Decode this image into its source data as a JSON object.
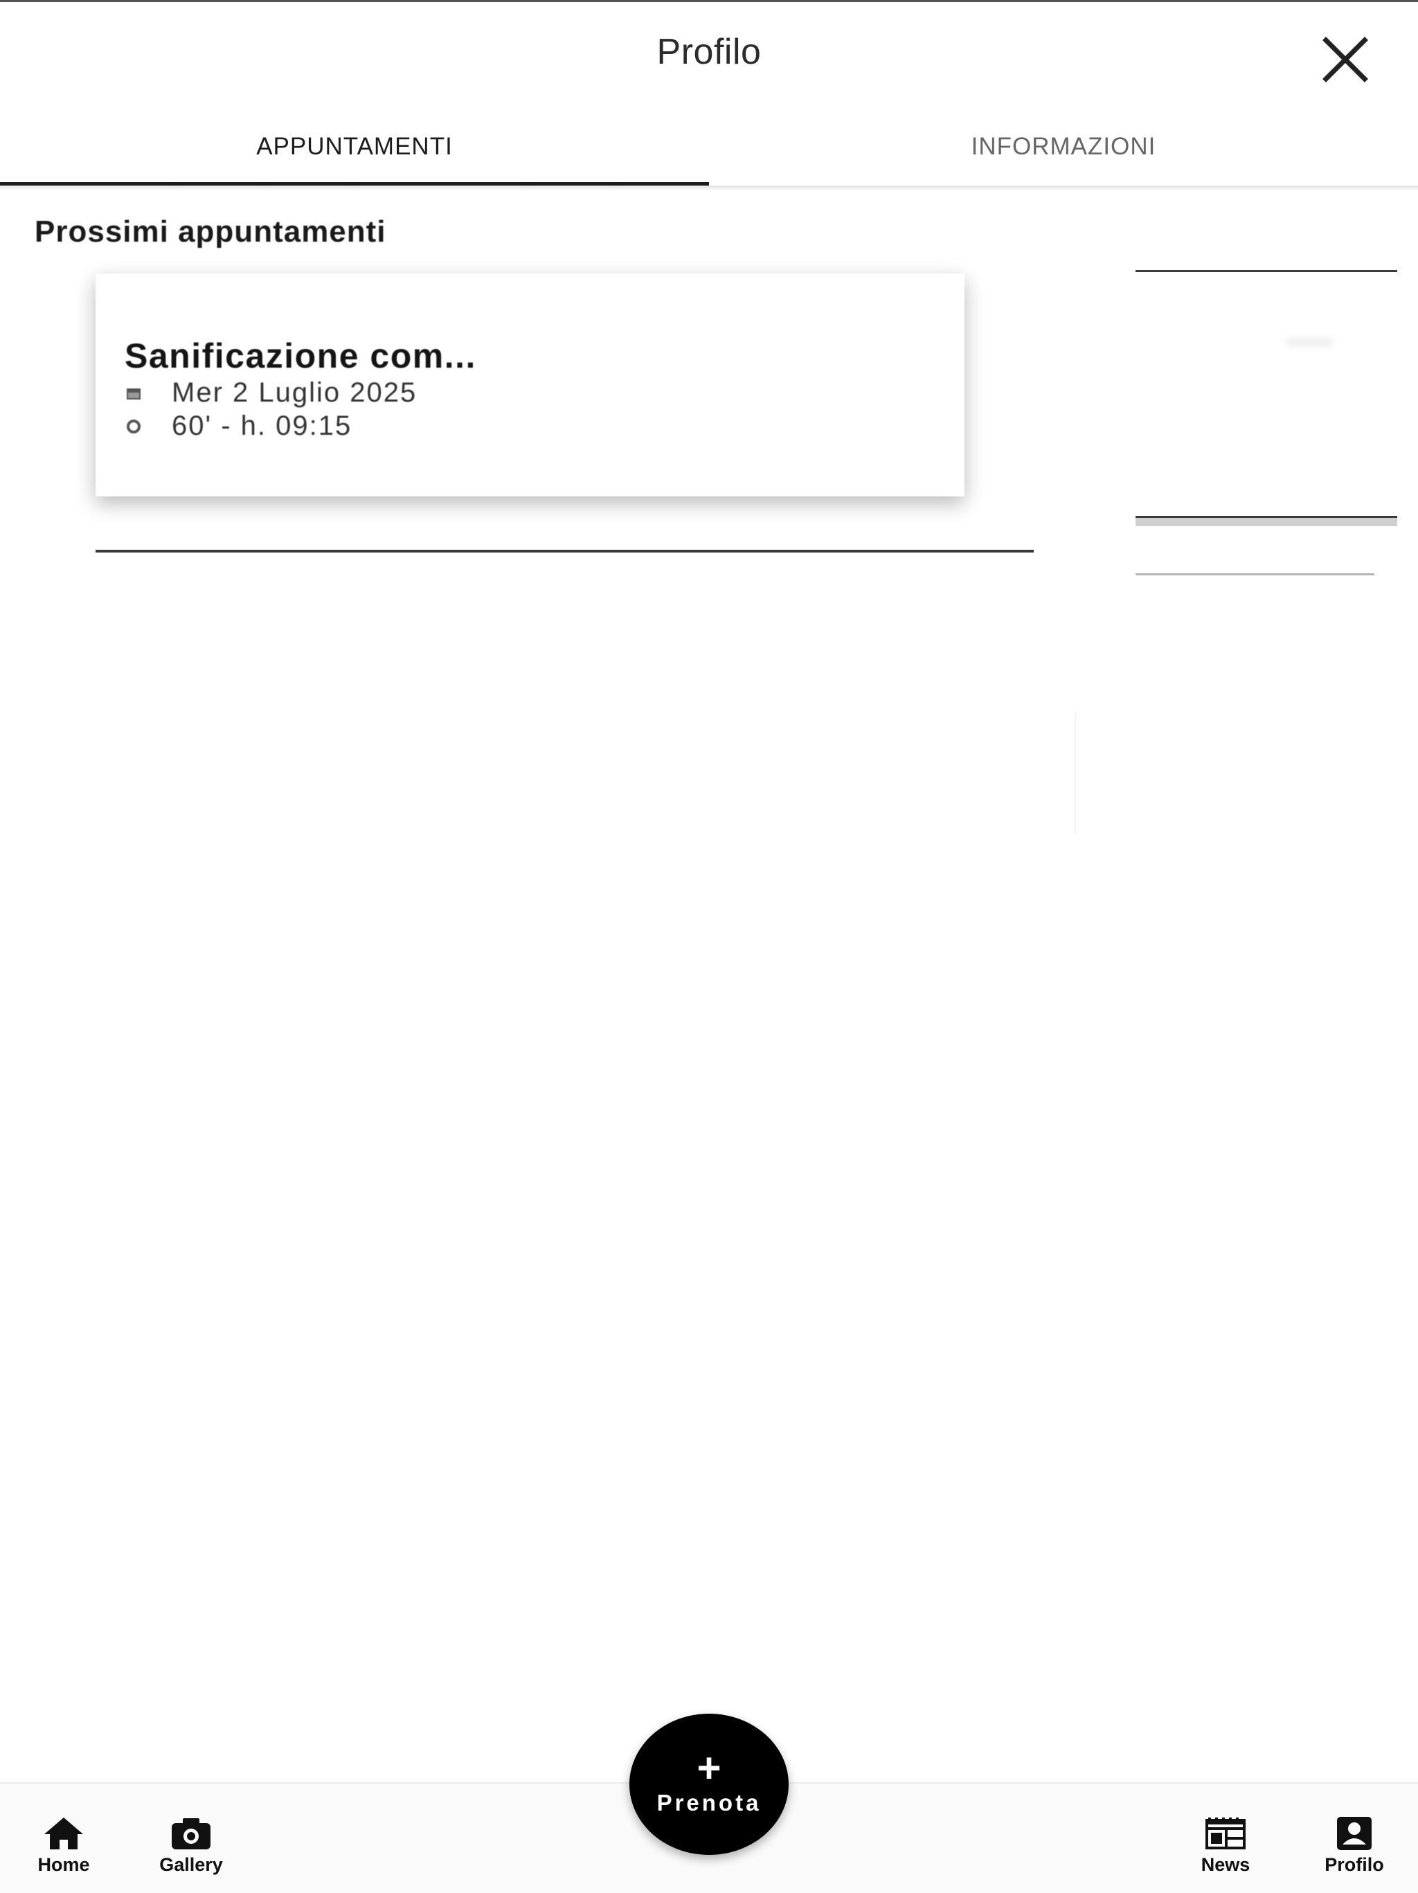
{
  "header": {
    "title": "Profilo",
    "close_icon": "close-icon"
  },
  "tabs": [
    {
      "label": "APPUNTAMENTI",
      "active": true
    },
    {
      "label": "INFORMAZIONI",
      "active": false
    }
  ],
  "main": {
    "section_heading": "Prossimi appuntamenti",
    "appointments": [
      {
        "title": "Sanificazione com...",
        "date_icon": "calendar-icon",
        "date": "Mer 2 Luglio 2025",
        "time_icon": "clock-icon",
        "time": "60' - h. 09:15"
      }
    ]
  },
  "fab": {
    "icon": "plus",
    "symbol": "+",
    "label": "Prenota"
  },
  "bottom_nav": [
    {
      "label": "Home",
      "icon": "home-icon"
    },
    {
      "label": "Gallery",
      "icon": "camera-icon"
    },
    {
      "label": "News",
      "icon": "news-icon"
    },
    {
      "label": "Profilo",
      "icon": "profile-icon"
    }
  ],
  "colors": {
    "primary": "#000000",
    "background": "#ffffff",
    "text": "#222222",
    "inactive_tab": "#666666"
  }
}
